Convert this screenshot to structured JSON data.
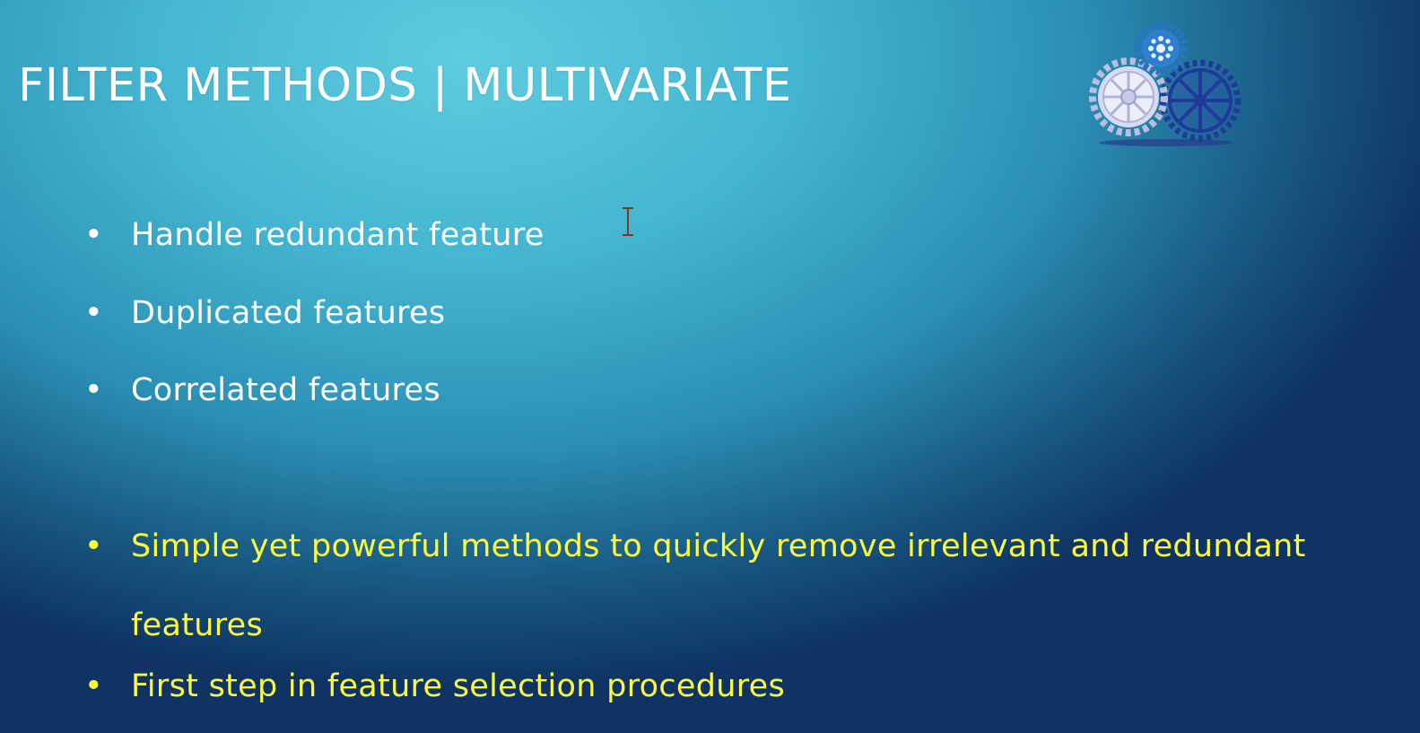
{
  "slide": {
    "title": "FILTER METHODS | MULTIVARIATE",
    "bullet_symbol": "•",
    "white_bullets": [
      "Handle redundant feature",
      "Duplicated features",
      "Correlated features"
    ],
    "yellow_bullets": [
      "Simple yet powerful methods to quickly remove irrelevant and redundant features",
      "First step in feature selection procedures"
    ],
    "colors": {
      "title": "#ffffff",
      "white_text": "#ffffff",
      "highlight_text": "#fbfb3f",
      "background_light": "#5ecbde",
      "background_dark": "#0f3463"
    },
    "logo_icon": "gears-icon",
    "cursor_icon": "text-cursor-icon"
  }
}
